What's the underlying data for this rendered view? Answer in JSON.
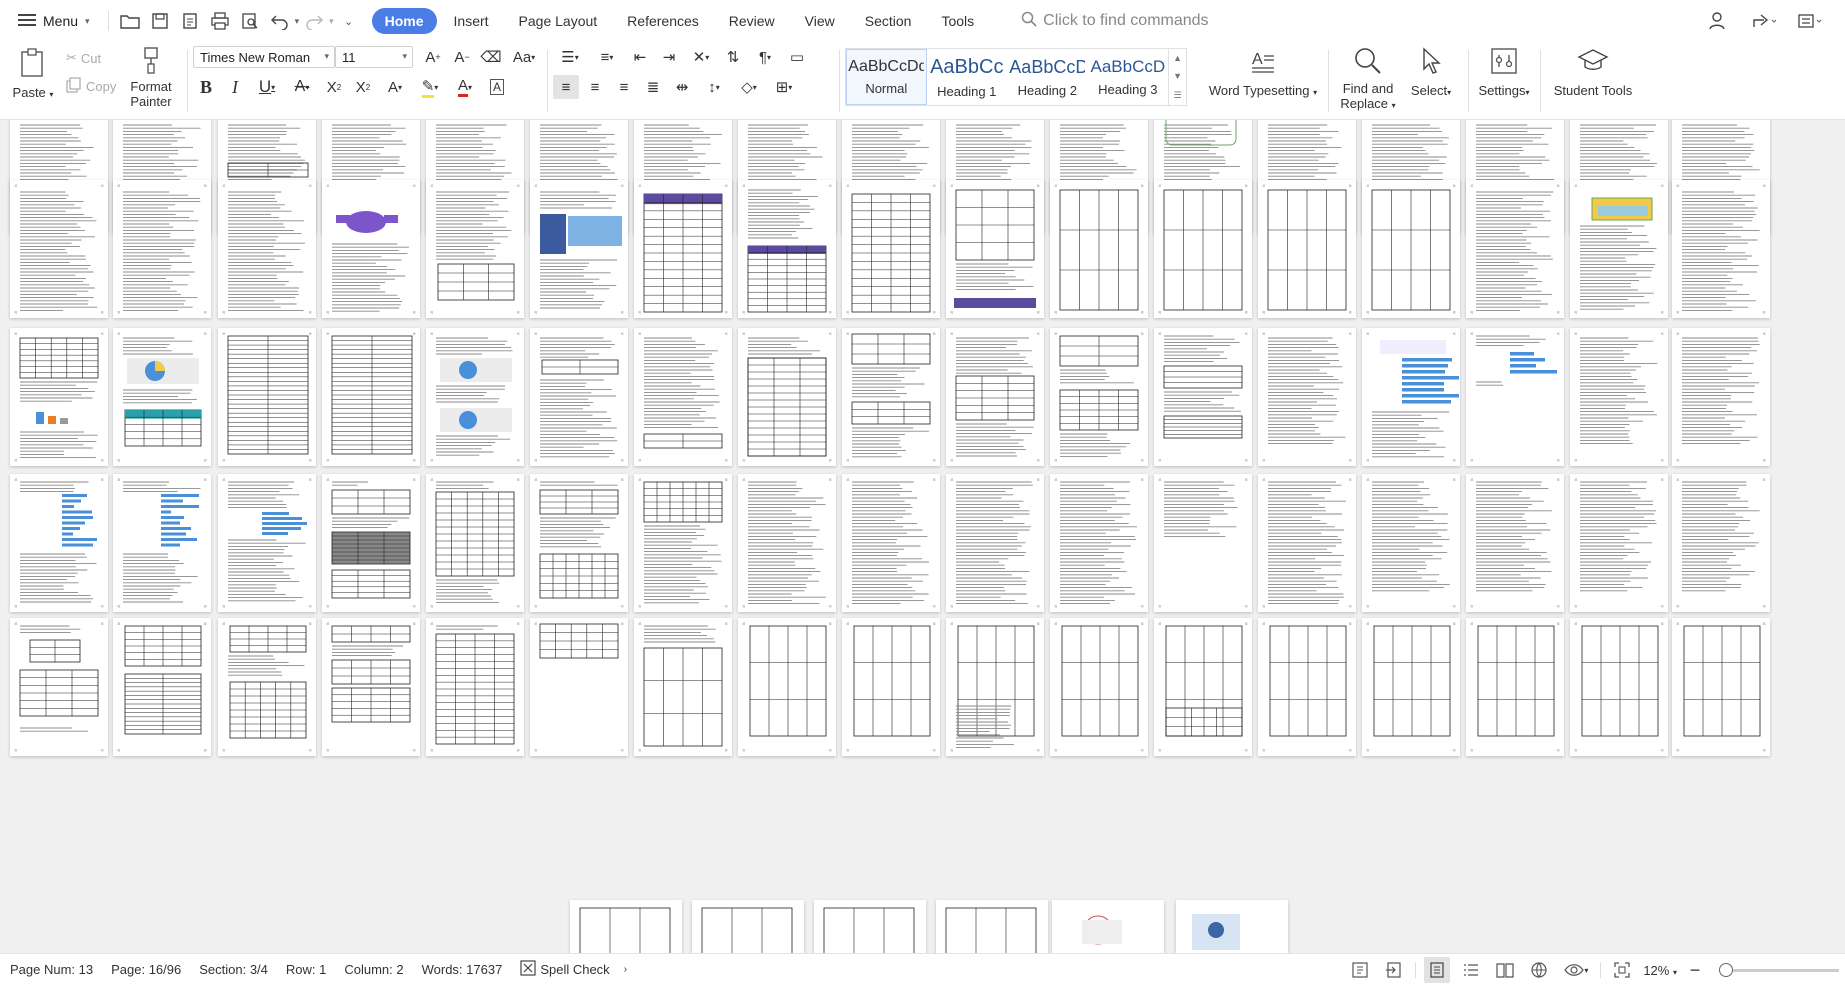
{
  "topbar": {
    "menu_label": "Menu",
    "tabs": [
      "Home",
      "Insert",
      "Page Layout",
      "References",
      "Review",
      "View",
      "Section",
      "Tools"
    ],
    "find_placeholder": "Click to find commands"
  },
  "ribbon": {
    "paste_label": "Paste",
    "cut_label": "Cut",
    "copy_label": "Copy",
    "format_painter_line1": "Format",
    "format_painter_line2": "Painter",
    "font_name": "Times New Roman",
    "font_size": "11",
    "styles": [
      {
        "preview": "AaBbCcDd",
        "name": "Normal"
      },
      {
        "preview": "AaBbCc",
        "name": "Heading 1"
      },
      {
        "preview": "AaBbCcD",
        "name": "Heading 2"
      },
      {
        "preview": "AaBbCcD",
        "name": "Heading 3"
      }
    ],
    "word_typesetting_label": "Word Typesetting",
    "find_replace_line1": "Find and",
    "find_replace_line2": "Replace",
    "select_label": "Select",
    "settings_label": "Settings",
    "student_tools_label": "Student Tools"
  },
  "status": {
    "page_num": "Page Num: 13",
    "page": "Page: 16/96",
    "section": "Section: 3/4",
    "row": "Row: 1",
    "column": "Column: 2",
    "words": "Words: 17637",
    "spell_check": "Spell Check",
    "zoom": "12%"
  },
  "colors": {
    "accent": "#4a7ee6",
    "heading": "#2b5797",
    "purple_table": "#5b4a9e",
    "blue_chart": "#4a90d9",
    "teal_table": "#2aa0a8",
    "green_table": "#3c8c3c"
  }
}
